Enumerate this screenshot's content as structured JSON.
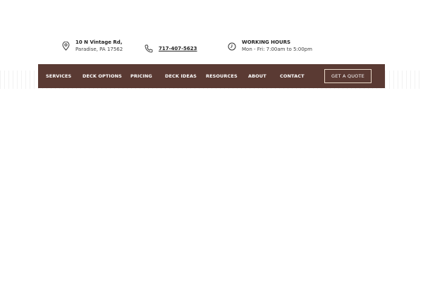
{
  "header": {
    "address": {
      "icon": "map-pin-icon",
      "line1": "10 N Vintage Rd,",
      "line2": "Paradise, PA 17562"
    },
    "phone": {
      "icon": "phone-icon",
      "number": "717-407-5623"
    },
    "hours": {
      "icon": "clock-icon",
      "title": "WORKING HOURS",
      "detail": "Mon - Fri: 7:00am to 5:00pm"
    }
  },
  "nav": {
    "items": [
      {
        "label": "SERVICES"
      },
      {
        "label": "DECK OPTIONS"
      },
      {
        "label": "PRICING"
      },
      {
        "label": "DECK IDEAS"
      },
      {
        "label": "RESOURCES"
      },
      {
        "label": "ABOUT"
      },
      {
        "label": "CONTACT"
      }
    ],
    "cta_label": "GET A QUOTE"
  },
  "colors": {
    "nav_background": "#5a3a33",
    "cta_border": "#e8d8c8",
    "text_dark": "#222222"
  }
}
